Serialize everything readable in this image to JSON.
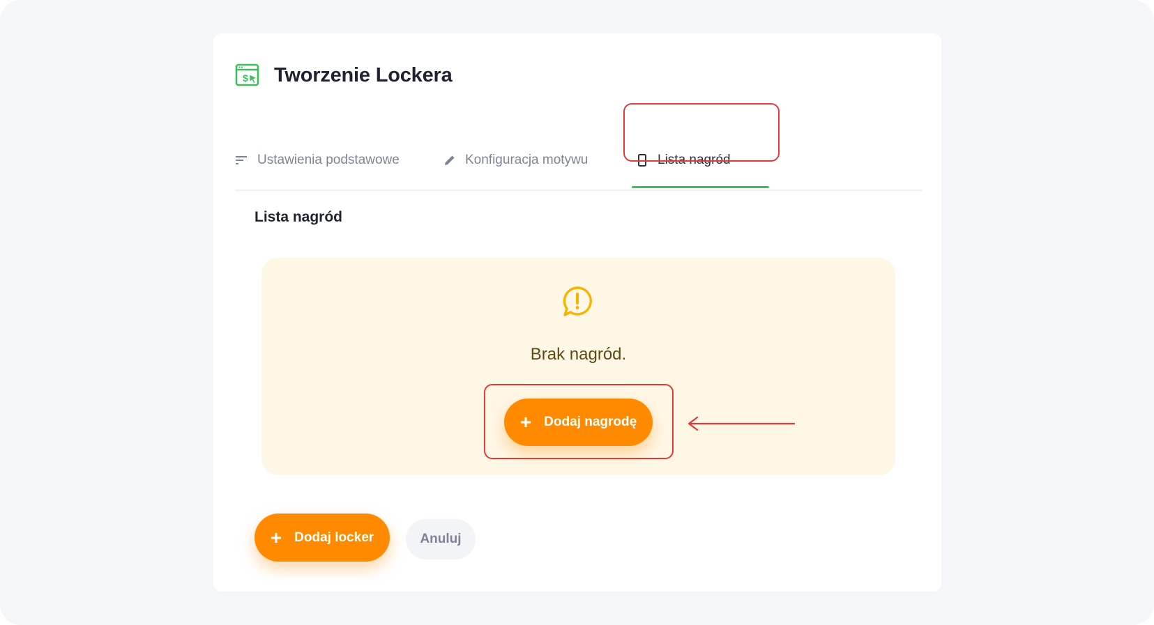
{
  "page": {
    "title": "Tworzenie Lockera",
    "logo_icon": "browser-dollar-cursor-icon"
  },
  "tabs": [
    {
      "label": "Ustawienia podstawowe",
      "icon": "sort-lines-icon",
      "active": false
    },
    {
      "label": "Konfiguracja motywu",
      "icon": "pencil-icon",
      "active": false
    },
    {
      "label": "Lista nagród",
      "icon": "phone-icon",
      "active": true
    }
  ],
  "section": {
    "title": "Lista nagród"
  },
  "empty_state": {
    "icon": "alert-chat-icon",
    "message": "Brak nagród.",
    "button_label": "Dodaj nagrodę",
    "button_icon": "plus-icon"
  },
  "footer": {
    "primary_label": "Dodaj locker",
    "secondary_label": "Anuluj"
  },
  "colors": {
    "accent": "#ff8a00",
    "active_tab_underline": "#3fbd5c",
    "highlight": "#e53935",
    "empty_bg": "#fff7e6",
    "brand_green": "#3fbd5c"
  }
}
